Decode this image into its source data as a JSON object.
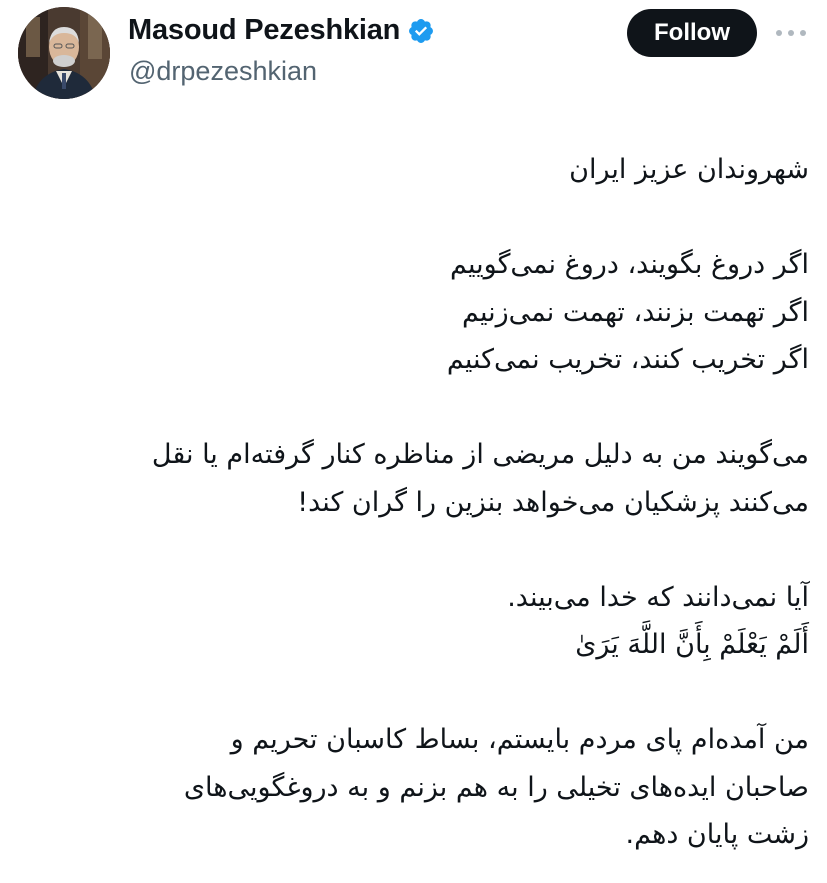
{
  "author": {
    "display_name": "Masoud Pezeshkian",
    "handle": "@drpezeshkian",
    "verified_icon": "verified-badge-icon",
    "verified_color": "#1d9bf0"
  },
  "actions": {
    "follow_label": "Follow",
    "more_icon": "more-options-icon"
  },
  "tweet": {
    "paragraphs": [
      [
        "شهروندان عزیز ایران"
      ],
      [
        "اگر دروغ بگویند، دروغ نمی‌گوییم",
        "اگر تهمت بزنند، تهمت نمی‌زنیم",
        "اگر تخریب کنند، تخریب نمی‌کنیم"
      ],
      [
        "می‌گویند من به دلیل مریضی از مناظره کنار گرفته‌ام یا نقل",
        "می‌کنند پزشکیان می‌خواهد بنزین را گران کند!"
      ],
      [
        "آیا نمی‌دانند که خدا می‌بیند.",
        "أَلَمْ یَعْلَمْ بِأَنَّ اللَّهَ یَرَىٰ"
      ],
      [
        "من آمده‌ام پای مردم بایستم، بساط کاسبان تحریم و",
        "صاحبان ایده‌های تخیلی را به هم بزنم و به دروغگویی‌های",
        "زشت پایان دهم."
      ]
    ]
  },
  "colors": {
    "text_primary": "#0f1419",
    "text_secondary": "#536471",
    "follow_bg": "#0f1419",
    "follow_text": "#ffffff"
  }
}
